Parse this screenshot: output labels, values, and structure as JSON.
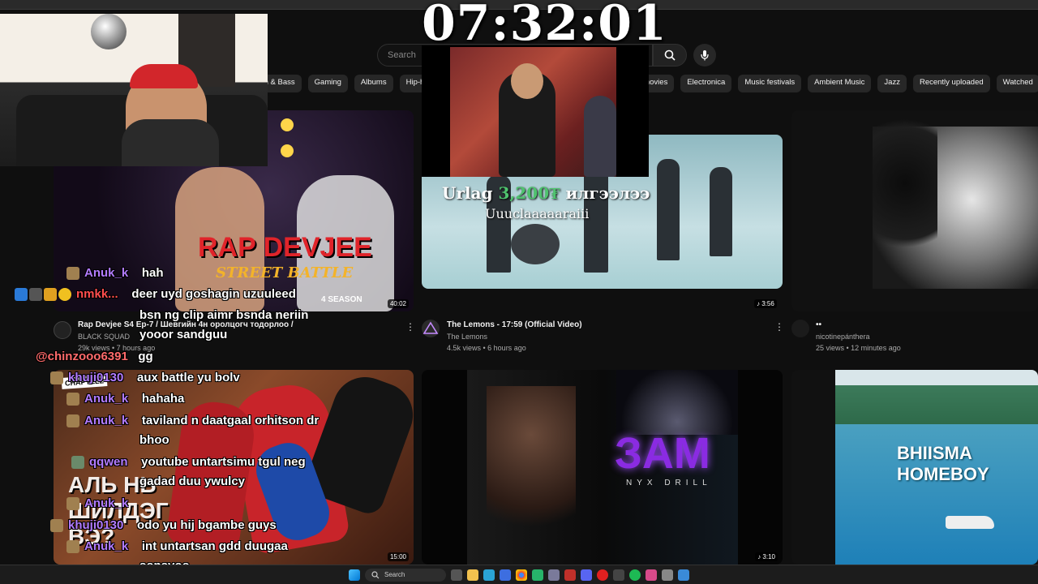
{
  "clock": "07:32:01",
  "search": {
    "placeholder": "Search"
  },
  "chips": [
    "m & Bass",
    "Gaming",
    "Albums",
    "Hip-h",
    "o movies",
    "Electronica",
    "Music festivals",
    "Ambient Music",
    "Jazz",
    "Recently uploaded",
    "Watched"
  ],
  "videos": [
    {
      "title": "Rap Devjee S4 Ep-7 / Шевгийн 4н оролцогч тодорлоо /",
      "channel": "BLACK SQUAD",
      "meta": "29k views • 7 hours ago",
      "duration": "40:02",
      "thumb_text": "RAP DEVJEE",
      "thumb_sub": "STREET BATTLE",
      "thumb_season": "4 SEASON"
    },
    {
      "title": "The Lemons - 17:59 (Official Video)",
      "channel": "The Lemons",
      "meta": "4.5k views • 6 hours ago",
      "duration": "3:56"
    },
    {
      "title": "••",
      "channel": "nicotinepánthera",
      "meta": "25 views • 12 minutes ago"
    },
    {
      "thumb_text": "АЛЬ НЬ ШИЛДЭГ ВЭ?",
      "badge": "CHAPTELL",
      "duration": "15:00"
    },
    {
      "thumb_text": "ЗАМ",
      "thumb_sub": "NYX DRILL",
      "duration": "3:10"
    },
    {
      "thumb_text": "BHIISMA HOMEBOY"
    }
  ],
  "overlay": {
    "alert_prefix": "Urlag",
    "alert_amount": "3,200₮",
    "alert_suffix": "илгээлээ",
    "alert_message": "Uuuclaaaaaraiii"
  },
  "chat": [
    {
      "name": "Anuk_k",
      "msg": "hah"
    },
    {
      "name": "nmkk...",
      "msg": "deer uyd goshagin uzuuleed"
    },
    {
      "name": "",
      "msg": "bsn ng clip aimr bsnda neriin"
    },
    {
      "name": "",
      "msg": "yooor sandguu"
    },
    {
      "name": "@chinzooo6391",
      "msg": "gg"
    },
    {
      "name": "khuji0130",
      "msg": "aux battle yu bolv"
    },
    {
      "name": "Anuk_k",
      "msg": "hahaha"
    },
    {
      "name": "Anuk_k",
      "msg": "taviland n daatgaal orhitson dr"
    },
    {
      "name": "",
      "msg": "bhoo"
    },
    {
      "name": "qqwen",
      "msg": "youtube untartsimu tgul neg"
    },
    {
      "name": "",
      "msg": "gadad duu ywulcy"
    },
    {
      "name": "Anuk_k",
      "msg": ""
    },
    {
      "name": "khuji0130",
      "msg": "odo yu hij bgambe guys"
    },
    {
      "name": "Anuk_k",
      "msg": "int untartsan gdd duugaa"
    },
    {
      "name": "",
      "msg": "sonsyoo"
    }
  ],
  "taskbar": {
    "search_label": "Search"
  }
}
